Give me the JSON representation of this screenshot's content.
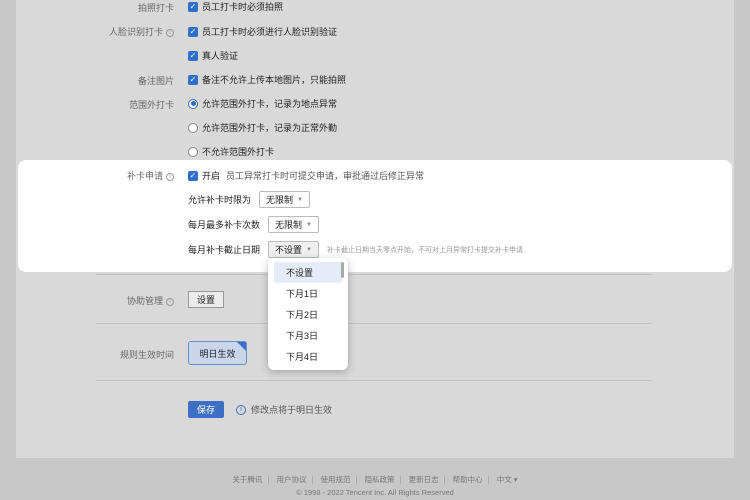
{
  "settings": {
    "photo_punch": {
      "label": "拍照打卡",
      "option": "员工打卡时必须拍照"
    },
    "face_punch": {
      "label": "人脸识别打卡",
      "option1": "员工打卡时必须进行人脸识别验证",
      "option2": "真人验证"
    },
    "remark_photo": {
      "label": "备注图片",
      "option": "备注不允许上传本地图片，只能拍照"
    },
    "out_of_range": {
      "label": "范围外打卡",
      "options": [
        "允许范围外打卡，记录为地点异常",
        "允许范围外打卡，记录为正常外勤",
        "不允许范围外打卡"
      ],
      "selected_index": 0
    },
    "makeup": {
      "label": "补卡申请",
      "enable_label": "开启",
      "hint": "员工异常打卡时可提交申请，审批通过后修正异常",
      "time_limit": {
        "label": "允许补卡时限为",
        "value": "无限制"
      },
      "monthly_max": {
        "label": "每月最多补卡次数",
        "value": "无限制"
      },
      "monthly_deadline": {
        "label": "每月补卡截止日期",
        "value": "不设置",
        "hint": "补卡截止日期当天零点开始，不可对上月异常打卡提交补卡申请"
      }
    },
    "assist": {
      "label": "协助管理",
      "button": "设置"
    },
    "effective": {
      "label": "规则生效时间",
      "option": "明日生效"
    },
    "save": {
      "button": "保存",
      "hint": "修改点将于明日生效"
    }
  },
  "dropdown": {
    "options": [
      "不设置",
      "下月1日",
      "下月2日",
      "下月3日",
      "下月4日"
    ],
    "active_index": 0
  },
  "footer": {
    "links": [
      "关于腾讯",
      "用户协议",
      "使用规范",
      "隐私政策",
      "更新日志",
      "帮助中心",
      "中文 ▾"
    ],
    "copyright": "© 1998 - 2022 Tencent Inc. All Rights Reserved"
  },
  "colors": {
    "accent": "#2f6fcc",
    "overlay_bg": "#c8c8c8",
    "panel_bg": "#ffffff"
  }
}
